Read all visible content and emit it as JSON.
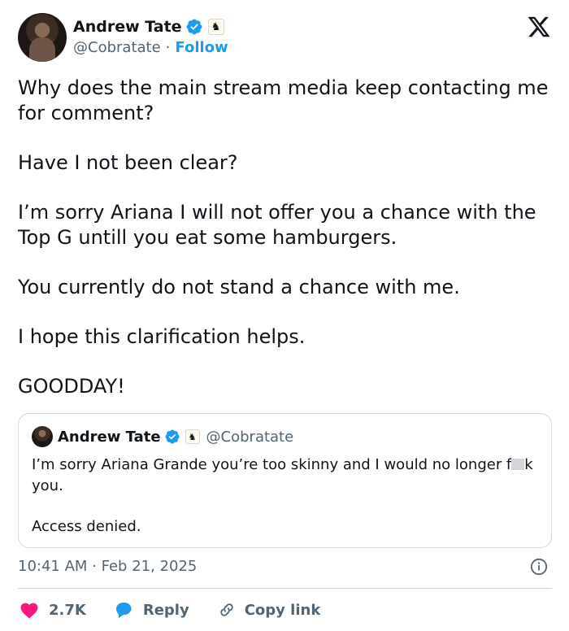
{
  "author": {
    "name": "Andrew Tate",
    "handle": "@Cobratate",
    "separator": "·",
    "follow_label": "Follow"
  },
  "tweet": {
    "paragraphs": [
      "Why does the main stream media keep contacting me for comment?",
      "Have I not been clear?",
      "I’m sorry Ariana I will not offer you a chance with the Top G untill you eat some hamburgers.",
      "You currently do not stand a chance with me.",
      "I hope this clarification helps.",
      "GOODDAY!"
    ]
  },
  "quote": {
    "name": "Andrew Tate",
    "handle": "@Cobratate",
    "line1_a": "I’m sorry Ariana Grande you’re too skinny and I would no longer f",
    "line1_b": "k you.",
    "line2": "Access denied."
  },
  "meta": {
    "timestamp": "10:41 AM · Feb 21, 2025"
  },
  "actions": {
    "likes": "2.7K",
    "reply_label": "Reply",
    "copy_link_label": "Copy link"
  },
  "colors": {
    "accent": "#1d9bf0",
    "heart": "#f91880",
    "muted": "#536471",
    "text": "#0f1419"
  },
  "icons": [
    "verified-badge-icon",
    "knight-affiliate-icon",
    "x-logo-icon",
    "info-icon",
    "heart-icon",
    "reply-icon",
    "link-icon"
  ]
}
